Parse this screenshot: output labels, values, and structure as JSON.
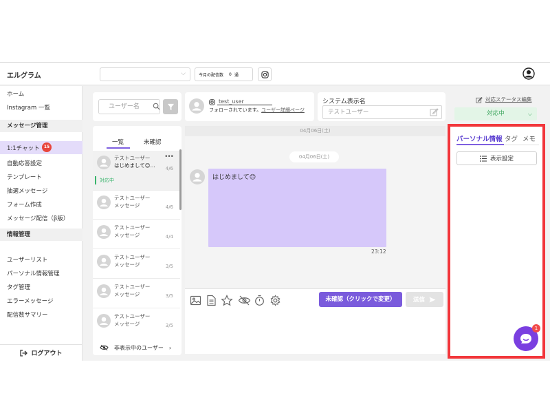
{
  "header": {
    "app_title": "エルグラム",
    "monthly_label": "今月の配信数",
    "monthly_count": "0",
    "monthly_unit": "通"
  },
  "sidebar": {
    "top_items": [
      {
        "label": "ホーム"
      },
      {
        "label": "Instagram 一覧"
      }
    ],
    "section_messages": "メッセージ管理",
    "message_items": [
      {
        "label": "1:1チャット",
        "badge": "15"
      },
      {
        "label": "自動応答設定"
      },
      {
        "label": "テンプレート"
      },
      {
        "label": "抽選メッセージ"
      },
      {
        "label": "フォーム作成"
      },
      {
        "label": "メッセージ配信（β版）"
      }
    ],
    "section_info": "情報管理",
    "info_items": [
      {
        "label": "ユーザーリスト"
      },
      {
        "label": "パーソナル情報管理"
      },
      {
        "label": "タグ管理"
      },
      {
        "label": "エラーメッセージ"
      },
      {
        "label": "配信数サマリー"
      }
    ],
    "logout_label": "ログアウト"
  },
  "user_list": {
    "search_placeholder": "ユーザー名",
    "tab_all": "一覧",
    "tab_unconfirmed": "未確認",
    "users": [
      {
        "name": "テストユーザー",
        "message": "はじめまして😊...",
        "date": "4/6",
        "status": "対応中"
      },
      {
        "name": "テストユーザー",
        "message": "メッセージ",
        "date": "4/6"
      },
      {
        "name": "テストユーザー",
        "message": "メッセージ",
        "date": "4/4"
      },
      {
        "name": "テストユーザー",
        "message": "メッセージ",
        "date": "3/5"
      },
      {
        "name": "テストユーザー",
        "message": "メッセージ",
        "date": "3/5"
      },
      {
        "name": "テストユーザー",
        "message": "メッセージ",
        "date": "3/5"
      }
    ],
    "hidden_users_label": "非表示中のユーザー"
  },
  "chat_header": {
    "username": "test_user",
    "follow_text": "フォローされています。",
    "detail_link": "ユーザー詳細ページ",
    "system_name_label": "システム表示名",
    "system_name_value": "テストユーザー",
    "status_edit_label": "対応ステータス編集",
    "status_value": "対応中"
  },
  "chat": {
    "date_top": "04月06日(土)",
    "date_pill": "04月06日(土)",
    "message": "はじめまして😊",
    "time": "23:12"
  },
  "composer": {
    "unconfirmed_button": "未確認（クリックで変更）",
    "send_button": "送信"
  },
  "right_panel": {
    "tab_personal": "パーソナル情報",
    "tab_tag": "タグ",
    "tab_memo": "メモ",
    "display_settings": "表示設定",
    "fab_badge": "1"
  },
  "colors": {
    "accent": "#7a5bdc",
    "bubble": "#d6c8fa",
    "status_green": "#38a35a",
    "highlight_red": "#f2363b",
    "badge_red": "#e8453c"
  }
}
